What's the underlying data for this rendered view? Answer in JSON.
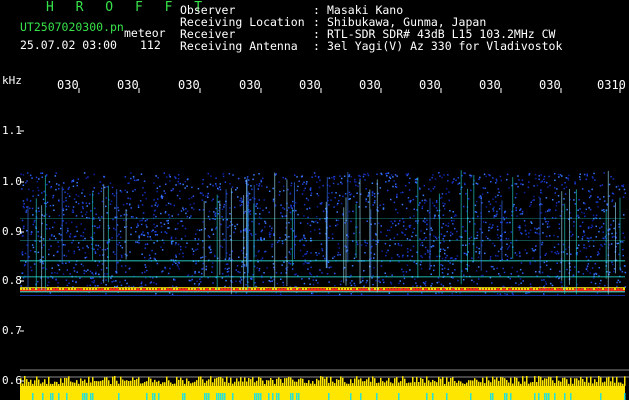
{
  "header": {
    "brand": "H R O F F T",
    "file_name": "UT2507020300.pn",
    "file_suffix": "meteor",
    "datetime": "25.07.02 03:00",
    "count": "112"
  },
  "info": [
    {
      "label": "Observer",
      "value": "Masaki Kano"
    },
    {
      "label": "Receiving Location",
      "value": "Shibukawa, Gunma, Japan"
    },
    {
      "label": "Receiver",
      "value": "RTL-SDR SDR# 43dB L15 103.2MHz CW"
    },
    {
      "label": "Receiving Antenna",
      "value": "3el Yagi(V) Az 330 for Vladivostok"
    }
  ],
  "colon": ":",
  "axis": {
    "y_unit": "kHz",
    "y_ticks": [
      "1.1",
      "1.0",
      "0.9",
      "0.8",
      "0.7",
      "0.6"
    ],
    "x_ticks": [
      "030",
      "030",
      "030",
      "030",
      "030",
      "030",
      "030",
      "030",
      "030",
      "0310"
    ]
  },
  "colors": {
    "header_green": "#37e34a",
    "text_white": "#ffffff",
    "background": "#000000",
    "band_red": "#ff2a1a",
    "band_yellow": "#ffe600",
    "band_cyan": "#27e0d6",
    "noise_blue": "#1a3fd8"
  }
}
